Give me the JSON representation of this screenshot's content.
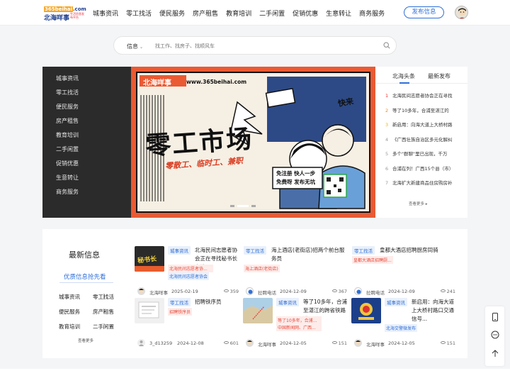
{
  "logo": {
    "top": "365beihai.com",
    "top_prefix": "365beihai",
    "top_suffix": ".com",
    "name": "北海咩事",
    "tagline": "生活信息发布平台"
  },
  "nav": [
    "城事资讯",
    "零工找活",
    "便民服务",
    "房产租售",
    "教育培训",
    "二手闲置",
    "促销优惠",
    "生意转让",
    "商务服务"
  ],
  "header": {
    "publish_label": "发布信息"
  },
  "search": {
    "category": "信息",
    "placeholder": "找工作、找房子、找顺风车"
  },
  "sidebar": {
    "items": [
      "城事资讯",
      "零工找活",
      "便民服务",
      "房产租售",
      "教育培训",
      "二手闲置",
      "促销优惠",
      "生意转让",
      "商务服务"
    ]
  },
  "banner": {
    "brand": "北海咩事",
    "url": "www.365beihai.com",
    "title": "零工市场",
    "subtitle": "零散工、临时工、兼职",
    "bubble": "快来",
    "slogan1": "免注册 快人一步",
    "slogan2": "免费呀 发布无坑"
  },
  "news_panel": {
    "tabs": [
      "北海头条",
      "最新发布"
    ],
    "items": [
      {
        "rank": "1",
        "title": "北海民间志愿者协会正在寻找"
      },
      {
        "rank": "2",
        "title": "等了10多年，合浦至湛江的"
      },
      {
        "rank": "3",
        "title": "新启用：向海大道上大桥村路"
      },
      {
        "rank": "4",
        "title": "《广西壮族自治区多元化解纠"
      },
      {
        "rank": "5",
        "title": "多个\"群聊\"里已出现，千万"
      },
      {
        "rank": "6",
        "title": "合浦在列！广西15个县（市）"
      },
      {
        "rank": "7",
        "title": "北海扩大新建商品住房购房补"
      }
    ],
    "more": "查看更多"
  },
  "latest": {
    "title": "最新信息",
    "subtitle": "优质信息抢先看",
    "categories": [
      "城事资讯",
      "零工找活",
      "便民服务",
      "房产租售",
      "教育培训",
      "二手闲置"
    ],
    "more": "查看更多"
  },
  "cards": [
    {
      "tag": "城事资讯",
      "title": "北海民间志愿者协会正在寻找秘书长人选！",
      "subtags": [
        "北海民间志愿者协...",
        "北海民间志愿者协会"
      ],
      "author": "北海咩事",
      "date": "2025-02-19",
      "views": "359",
      "thumb_text": "秘书长"
    },
    {
      "tag": "零工找活",
      "title": "海上酒店(老街店)招两个前台服务员",
      "subtags": [
        "海上酒店(老街店)"
      ],
      "author": "拉聘电话",
      "date": "2024-12-09",
      "views": "367"
    },
    {
      "tag": "零工找活",
      "title": "皇都大酒店招聘厨房同骑",
      "subtags": [
        "皇都大酒店招聘厨..."
      ],
      "author": "拉聘电话",
      "date": "2024-12-09",
      "views": "241"
    },
    {
      "tag": "零工找活",
      "title": "招聘铁序员",
      "subtags": [
        "招聘铁序员"
      ],
      "author": "3_d13259",
      "date": "2024-12-08",
      "views": "601"
    },
    {
      "tag": "城事资讯",
      "title": "等了10多年，合浦至湛江的跨省铁路进入...",
      "subtags": [
        "中国新闻网、广西...",
        "等了10多年，合浦..."
      ],
      "author": "北海咩事",
      "date": "2024-12-05",
      "views": "151"
    },
    {
      "tag": "城事资讯",
      "title": "新启用：向海大道上大桥村路口交通信号...",
      "subtags": [
        "北海交警微发布"
      ],
      "author": "北海咩事",
      "date": "2024-12-05",
      "views": "151"
    }
  ],
  "colors": {
    "accent": "#2f6fd8",
    "banner_bg": "#ea5a33",
    "sidebar_bg": "#2b2b2b",
    "hot_rank": "#e8322c"
  }
}
